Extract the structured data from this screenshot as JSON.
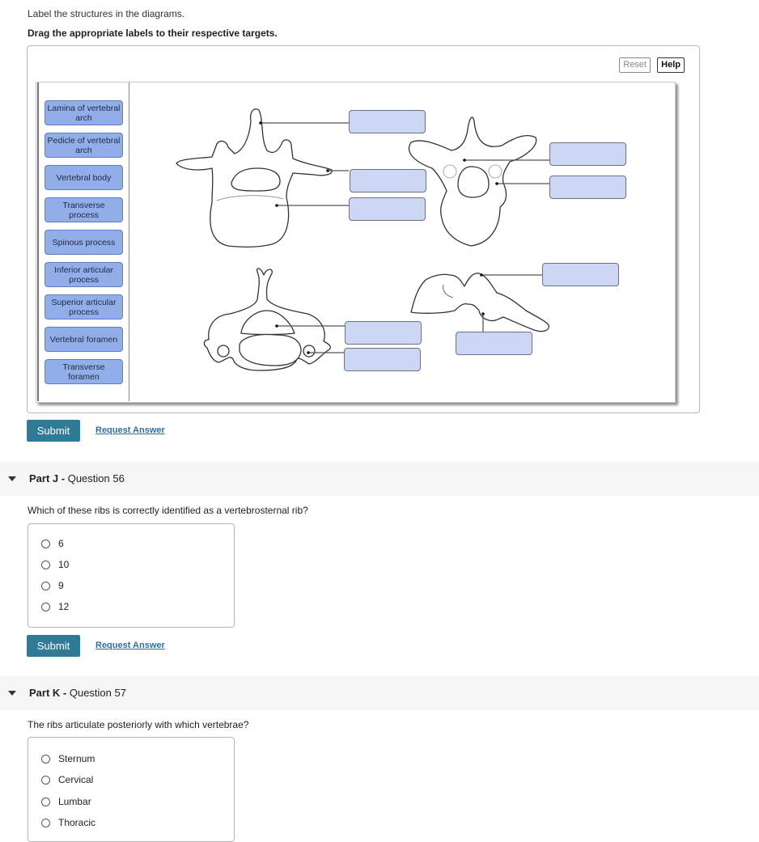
{
  "intro_text": "Label the structures in the diagrams.",
  "instructions": "Drag the appropriate labels to their respective targets.",
  "toolbar": {
    "reset_label": "Reset",
    "help_label": "Help"
  },
  "labels": [
    "Lamina of vertebral arch",
    "Pedicle of vertebral arch",
    "Vertebral body",
    "Transverse process",
    "Spinous process",
    "Inferior articular process",
    "Superior articular process",
    "Vertebral foramen",
    "Transverse foramen"
  ],
  "targets_count": 9,
  "colors": {
    "label_fill": "#92aee8",
    "target_fill": "#cbd7f3",
    "submit_bg": "#2f7b96",
    "link": "#2f6f9a"
  },
  "part_i": {
    "submit_label": "Submit",
    "request_answer_label": "Request Answer"
  },
  "part_j": {
    "part_label": "Part J -",
    "question_label": "Question 56",
    "question": "Which of these ribs is correctly identified as a vertebrosternal rib?",
    "options": [
      "6",
      "10",
      "9",
      "12"
    ],
    "submit_label": "Submit",
    "request_answer_label": "Request Answer"
  },
  "part_k": {
    "part_label": "Part K -",
    "question_label": "Question 57",
    "question": "The ribs articulate posteriorly with which vertebrae?",
    "options": [
      "Sternum",
      "Cervical",
      "Lumbar",
      "Thoracic"
    ]
  }
}
